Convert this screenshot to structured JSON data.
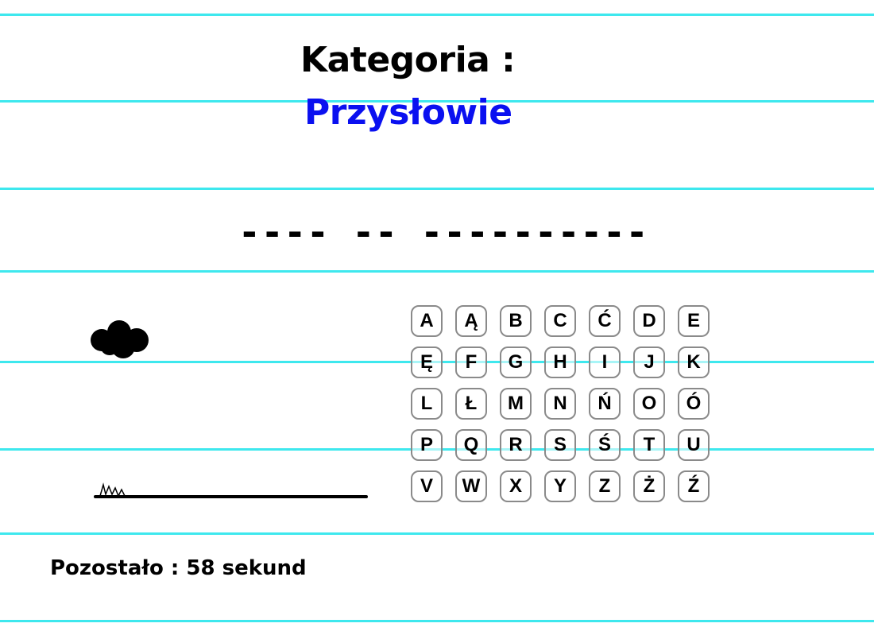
{
  "category": {
    "heading": "Kategoria :",
    "value": "Przysłowie",
    "value_color": "#0a10f0"
  },
  "puzzle": {
    "masked": "---- -- ----------"
  },
  "keyboard": {
    "keys": [
      "A",
      "Ą",
      "B",
      "C",
      "Ć",
      "D",
      "E",
      "Ę",
      "F",
      "G",
      "H",
      "I",
      "J",
      "K",
      "L",
      "Ł",
      "M",
      "N",
      "Ń",
      "O",
      "Ó",
      "P",
      "Q",
      "R",
      "S",
      "Ś",
      "T",
      "U",
      "V",
      "W",
      "X",
      "Y",
      "Z",
      "Ż",
      "Ź"
    ]
  },
  "timer": {
    "label": "Pozostało : 58 sekund"
  },
  "theme": {
    "rule_color": "#3ee8ee"
  },
  "scene": {
    "icons": [
      "cloud-icon",
      "grass-icon",
      "ground-line"
    ]
  }
}
